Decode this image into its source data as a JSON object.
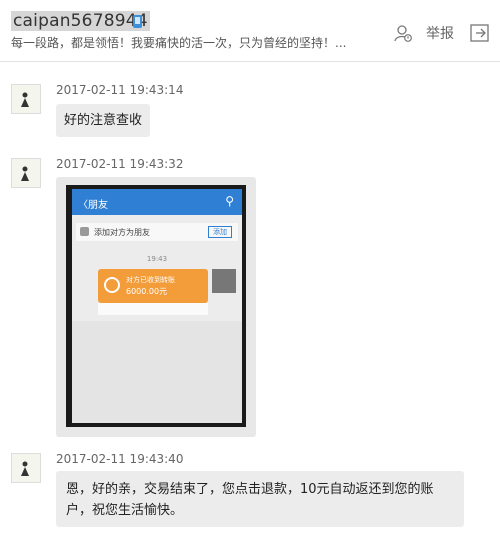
{
  "header": {
    "username": "caipan5678944",
    "signature": "每一段路，都是领悟！我要痛快的活一次，只为曾经的坚持！...",
    "report_label": "举报",
    "icons": {
      "device": "phone-icon",
      "report": "report-user-icon",
      "exit": "exit-icon"
    }
  },
  "messages": [
    {
      "timestamp": "2017-02-11 19:43:14",
      "text": "好的注意查收"
    },
    {
      "timestamp": "2017-02-11 19:43:32",
      "image": {
        "nav_back": "〈朋友",
        "add_row_text": "添加对方为朋友",
        "add_button": "添加",
        "chat_time": "19:43",
        "transfer_title": "对方已收到转账",
        "transfer_amount": "6000.00元"
      }
    },
    {
      "timestamp": "2017-02-11 19:43:40",
      "text": "恩，好的亲，交易结束了，您点击退款，10元自动返还到您的账户，祝您生活愉快。"
    }
  ],
  "colors": {
    "nav_blue": "#2f7fd4",
    "transfer_orange": "#f39c3a",
    "bubble_bg": "#ececec"
  }
}
